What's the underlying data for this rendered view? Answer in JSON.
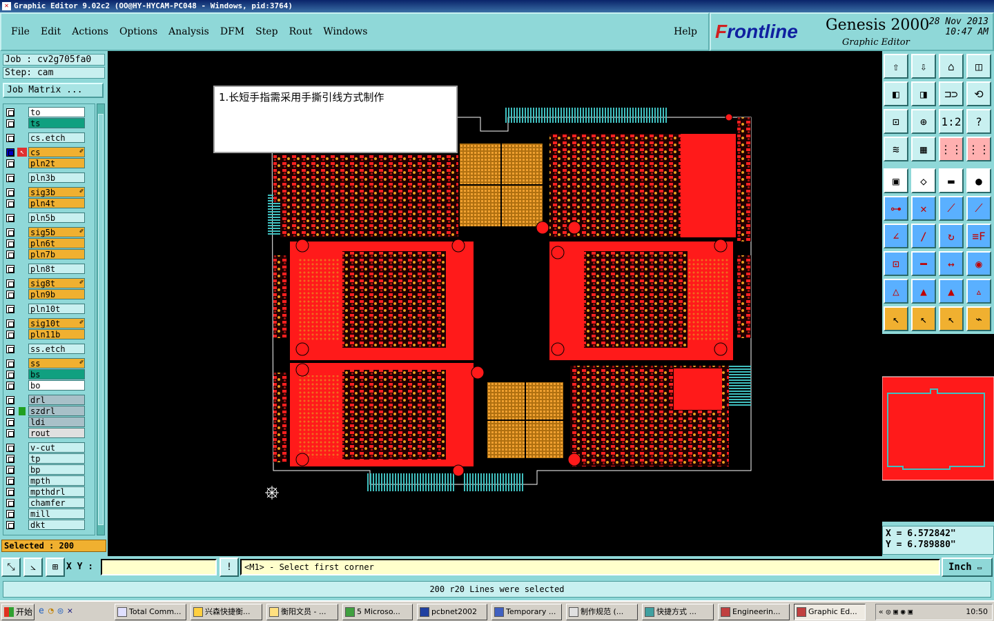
{
  "window": {
    "title": "Graphic Editor 9.02c2  (OO@HY-HYCAM-PC048 - Windows, pid:3764)"
  },
  "menu": {
    "items": [
      "File",
      "Edit",
      "Actions",
      "Options",
      "Analysis",
      "DFM",
      "Step",
      "Rout",
      "Windows"
    ],
    "help": "Help"
  },
  "logo": {
    "brand_prefix": "F",
    "brand": "rontline",
    "product": "Genesis 2000",
    "subtitle": "Graphic Editor",
    "date": "28 Nov 2013",
    "time": "10:47 AM"
  },
  "job": {
    "job": "Job : cv2g705fa0",
    "step": "Step: cam",
    "matrix_button": "Job Matrix ..."
  },
  "layers": [
    {
      "name": "to",
      "color": "#ffffff"
    },
    {
      "name": "ts",
      "color": "#10a080"
    },
    {
      "name": "cs.etch",
      "color": "#c8f0f0"
    },
    {
      "name": "cs",
      "color": "#f0b030",
      "active": true,
      "flag": "✐"
    },
    {
      "name": "pln2t",
      "color": "#f0b030"
    },
    {
      "name": "pln3b",
      "color": "#c8f0f0"
    },
    {
      "name": "sig3b",
      "color": "#f0b030",
      "flag": "✐"
    },
    {
      "name": "pln4t",
      "color": "#f0b030"
    },
    {
      "name": "pln5b",
      "color": "#c8f0f0"
    },
    {
      "name": "sig5b",
      "color": "#f0b030",
      "flag": "✐"
    },
    {
      "name": "pln6t",
      "color": "#f0b030"
    },
    {
      "name": "pln7b",
      "color": "#f0b030"
    },
    {
      "name": "pln8t",
      "color": "#c8f0f0"
    },
    {
      "name": "sig8t",
      "color": "#f0b030",
      "flag": "✐"
    },
    {
      "name": "pln9b",
      "color": "#f0b030"
    },
    {
      "name": "pln10t",
      "color": "#c8f0f0"
    },
    {
      "name": "sig10t",
      "color": "#f0b030",
      "flag": "✐"
    },
    {
      "name": "pln11b",
      "color": "#f0b030"
    },
    {
      "name": "ss.etch",
      "color": "#c8f0f0"
    },
    {
      "name": "ss",
      "color": "#f0b030",
      "flag": "✐"
    },
    {
      "name": "bs",
      "color": "#10a080"
    },
    {
      "name": "bo",
      "color": "#ffffff"
    },
    {
      "name": "drl",
      "color": "#a8c0c8"
    },
    {
      "name": "szdrl",
      "color": "#a8c0c8"
    },
    {
      "name": "ldi",
      "color": "#a8c0c8"
    },
    {
      "name": "rout",
      "color": "#e0e0e0"
    },
    {
      "name": "v-cut",
      "color": "#c8f0f0"
    },
    {
      "name": "tp",
      "color": "#c8f0f0"
    },
    {
      "name": "bp",
      "color": "#c8f0f0"
    },
    {
      "name": "mpth",
      "color": "#c8f0f0"
    },
    {
      "name": "mpthdrl",
      "color": "#c8f0f0"
    },
    {
      "name": "chamfer",
      "color": "#c8f0f0"
    },
    {
      "name": "mill",
      "color": "#c8f0f0"
    },
    {
      "name": "dkt",
      "color": "#c8f0f0"
    }
  ],
  "selected": "Selected : 200",
  "note": "1.长短手指需采用手撕引线方式制作",
  "coords": {
    "x": "X = 6.572842\"",
    "y": "Y = 6.789880\""
  },
  "command": {
    "xy_label": "X Y :",
    "xy_value": "",
    "prompt": "<M1> - Select first corner",
    "unit": "Inch"
  },
  "status": "200 r20 Lines were selected",
  "taskbar": {
    "start": "开始",
    "tasks": [
      "Total Comm...",
      "兴森快捷衡...",
      "衡阳文员 - ...",
      "5 Microso...",
      "pcbnet2002",
      "Temporary ...",
      "制作规范 (...",
      "快捷方式 ...",
      "Engineerin...",
      "Graphic Ed..."
    ],
    "clock": "10:50"
  },
  "colors": {
    "panel": "#8fd8d8",
    "copper": "#ff1a1a",
    "pad": "#e8a020",
    "finger": "#40c0c0"
  }
}
